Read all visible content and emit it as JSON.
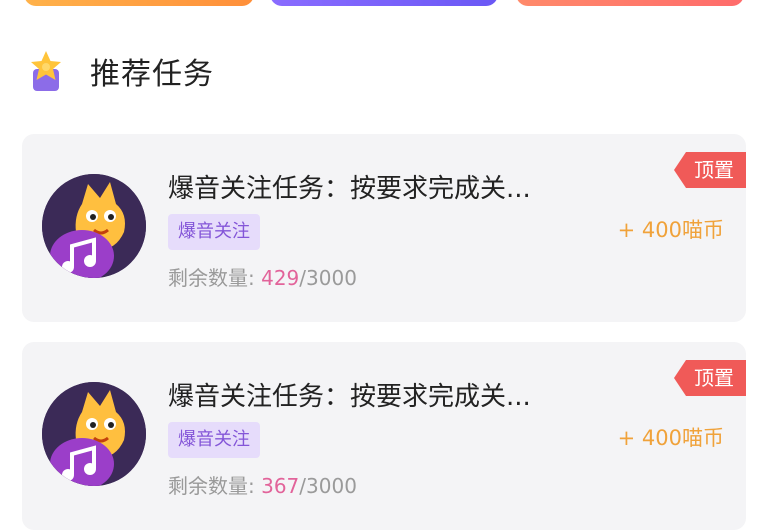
{
  "top_buttons": [
    {
      "color": "#ffa343"
    },
    {
      "color": "#7a62f8"
    },
    {
      "color": "#ff7a6a"
    }
  ],
  "section": {
    "title": "推荐任务",
    "icon": "star-trophy-icon"
  },
  "tasks": [
    {
      "title": "爆音关注任务：按要求完成关...",
      "tag": "爆音关注",
      "remaining_label": "剩余数量: ",
      "remaining": "429",
      "separator": "/",
      "total": "3000",
      "pin": "顶置",
      "reward": "+ 400喵币",
      "avatar_icon": "cat-music-avatar-icon"
    },
    {
      "title": "爆音关注任务：按要求完成关...",
      "tag": "爆音关注",
      "remaining_label": "剩余数量: ",
      "remaining": "367",
      "separator": "/",
      "total": "3000",
      "pin": "顶置",
      "reward": "+ 400喵币",
      "avatar_icon": "cat-music-avatar-icon"
    }
  ],
  "colors": {
    "accent_purple": "#8456d8",
    "pin_red": "#f05a58",
    "reward_orange": "#f0a23a",
    "remaining_pink": "#e2639a"
  }
}
